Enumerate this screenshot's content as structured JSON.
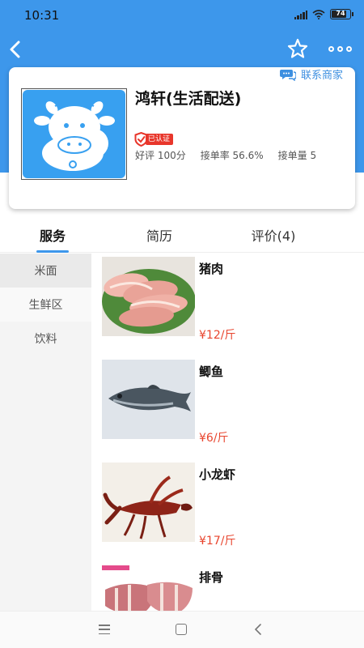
{
  "status_bar": {
    "time": "10:31",
    "battery": "74"
  },
  "header": {
    "back_icon": "chevron-left-icon",
    "favorite_icon": "star-outline-icon",
    "more_icon": "more-dots-icon",
    "color": "#3d97eb"
  },
  "shop": {
    "name": "鸿轩(生活配送)",
    "verified_label": "已认证",
    "contact_label": "联系商家",
    "rating": "好评 100分",
    "accept_rate": "接单率 56.6%",
    "order_count": "接单量 5",
    "logo_icon": "cow-logo-icon"
  },
  "tabs": [
    {
      "label": "服务"
    },
    {
      "label": "简历"
    },
    {
      "label": "评价(4)"
    }
  ],
  "categories": [
    {
      "label": "米面"
    },
    {
      "label": "生鲜区"
    },
    {
      "label": "饮料"
    }
  ],
  "products": [
    {
      "name": "猪肉",
      "price": "¥12/斤"
    },
    {
      "name": "鲫鱼",
      "price": "¥6/斤"
    },
    {
      "name": "小龙虾",
      "price": "¥17/斤"
    },
    {
      "name": "排骨",
      "price": ""
    }
  ],
  "colors": {
    "accent": "#3d97eb",
    "price": "#e8452e",
    "badge": "#e8362b"
  }
}
